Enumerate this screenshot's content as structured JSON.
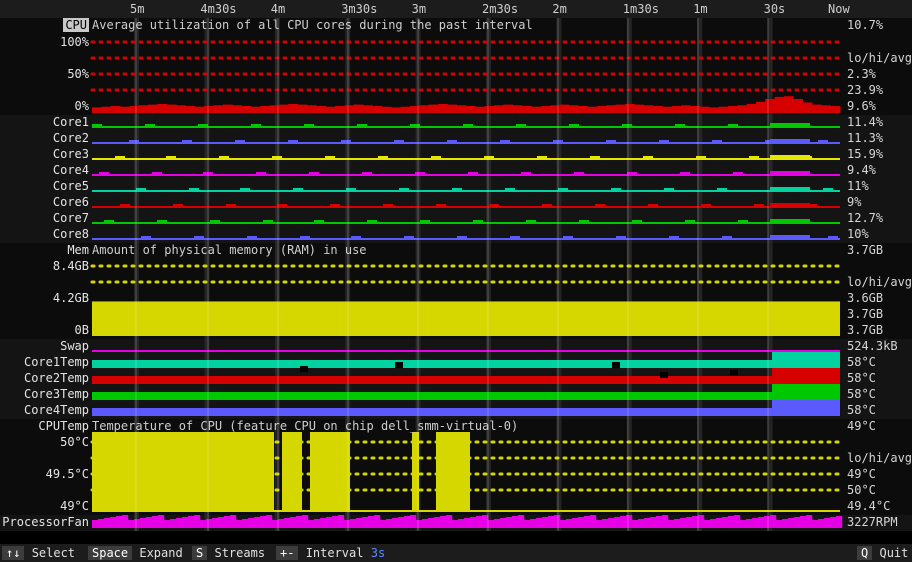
{
  "time_ruler": {
    "ticks": [
      {
        "label": "5m",
        "sec": -300
      },
      {
        "label": "4m30s",
        "sec": -270
      },
      {
        "label": "4m",
        "sec": -240
      },
      {
        "label": "3m30s",
        "sec": -210
      },
      {
        "label": "3m",
        "sec": -180
      },
      {
        "label": "2m30s",
        "sec": -150
      },
      {
        "label": "2m",
        "sec": -120
      },
      {
        "label": "1m30s",
        "sec": -90
      },
      {
        "label": "1m",
        "sec": -60
      },
      {
        "label": "30s",
        "sec": -30
      },
      {
        "label": "Now",
        "sec": 0
      }
    ]
  },
  "cpu": {
    "label": "CPU",
    "description": "Average utilization of all CPU cores during the past interval",
    "current": "10.7%",
    "axis": [
      "100%",
      "50%",
      "0%"
    ],
    "stats_header": "lo/hi/avg",
    "stats": [
      "2.3%",
      "23.9%",
      "9.6%"
    ],
    "color": "#d70000",
    "history_percent": [
      8,
      9,
      10,
      9,
      10,
      11,
      12,
      13,
      12,
      11,
      10,
      9,
      10,
      11,
      12,
      11,
      10,
      9,
      10,
      11,
      12,
      13,
      12,
      11,
      10,
      9,
      10,
      11,
      12,
      11,
      10,
      9,
      8,
      9,
      10,
      11,
      12,
      13,
      12,
      11,
      10,
      9,
      10,
      11,
      12,
      11,
      10,
      9,
      10,
      11,
      12,
      11,
      10,
      9,
      10,
      11,
      12,
      13,
      12,
      11,
      10,
      9,
      10,
      11,
      10,
      9,
      8,
      9,
      10,
      11,
      13,
      16,
      20,
      23,
      24,
      20,
      15,
      12,
      11,
      10
    ]
  },
  "cores": [
    {
      "label": "Core1",
      "value": "11.4%",
      "color": "#00c800"
    },
    {
      "label": "Core2",
      "value": "11.3%",
      "color": "#5a5aff"
    },
    {
      "label": "Core3",
      "value": "15.9%",
      "color": "#e6e600"
    },
    {
      "label": "Core4",
      "value": "9.4%",
      "color": "#e600e6"
    },
    {
      "label": "Core5",
      "value": "11%",
      "color": "#00d2a0"
    },
    {
      "label": "Core6",
      "value": "9%",
      "color": "#d70000"
    },
    {
      "label": "Core7",
      "value": "12.7%",
      "color": "#00c800"
    },
    {
      "label": "Core8",
      "value": "10%",
      "color": "#5a5aff"
    }
  ],
  "memory": {
    "label": "Mem",
    "description": "Amount of physical memory (RAM) in use",
    "current": "3.7GB",
    "axis": [
      "8.4GB",
      "4.2GB",
      "0B"
    ],
    "stats_header": "lo/hi/avg",
    "stats": [
      "3.6GB",
      "3.7GB",
      "3.7GB"
    ],
    "color": "#d7d700",
    "used_fraction": 0.44
  },
  "swap": {
    "label": "Swap",
    "value": "524.3kB",
    "color": "#e600e6"
  },
  "temps": [
    {
      "label": "Core1Temp",
      "value": "58°C",
      "color": "#00d2a0"
    },
    {
      "label": "Core2Temp",
      "value": "58°C",
      "color": "#d70000"
    },
    {
      "label": "Core3Temp",
      "value": "58°C",
      "color": "#00c800"
    },
    {
      "label": "Core4Temp",
      "value": "58°C",
      "color": "#5a5aff"
    }
  ],
  "cputemp": {
    "label": "CPUTemp",
    "description": "Temperature of CPU (feature CPU on chip dell_smm-virtual-0)",
    "current": "49°C",
    "axis": [
      "50°C",
      "49.5°C",
      "49°C"
    ],
    "stats_header": "lo/hi/avg",
    "stats": [
      "49°C",
      "50°C",
      "49.4°C"
    ],
    "color": "#d7d700"
  },
  "fan": {
    "label": "ProcessorFan",
    "value": "3227RPM",
    "color": "#e600e6"
  },
  "status_bar": {
    "select_key": "↑↓",
    "select_label": "Select",
    "expand_key": "Space",
    "expand_label": "Expand",
    "streams_key": "S",
    "streams_label": "Streams",
    "interval_key": "+-",
    "interval_label": "Interval",
    "interval_value": "3s",
    "quit_key": "Q",
    "quit_label": "Quit"
  }
}
